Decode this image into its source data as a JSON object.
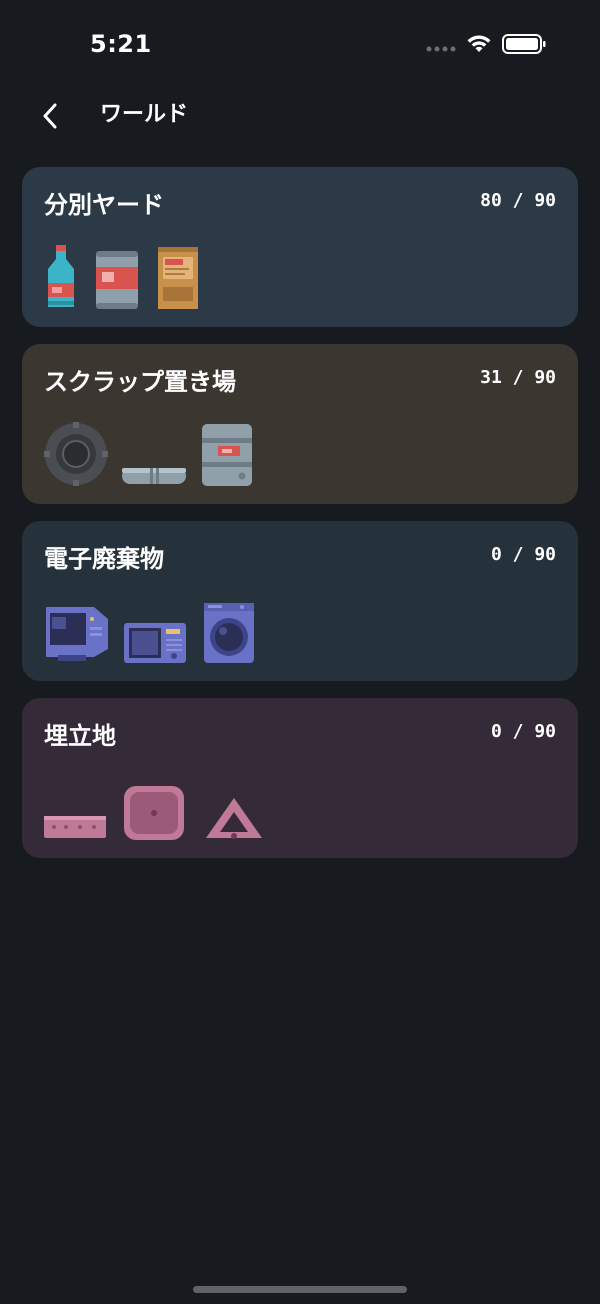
{
  "status_bar": {
    "time": "5:21"
  },
  "header": {
    "title": "ワールド",
    "back_icon": "chevron-left-icon"
  },
  "worlds": [
    {
      "name": "分別ヤード",
      "count": "80 / 90",
      "background": "#2b3a46",
      "items": [
        "bottle-icon",
        "can-icon",
        "cardboard-box-icon"
      ]
    },
    {
      "name": "スクラップ置き場",
      "count": "31 / 90",
      "background": "#3c3631",
      "items": [
        "tire-icon",
        "metal-pipe-icon",
        "oil-drum-icon"
      ]
    },
    {
      "name": "電子廃棄物",
      "count": "0 / 90",
      "background": "#26323b",
      "items": [
        "crt-monitor-icon",
        "microwave-icon",
        "washing-machine-icon"
      ]
    },
    {
      "name": "埋立地",
      "count": "0 / 90",
      "background": "#352b38",
      "items": [
        "plank-icon",
        "plastic-tray-icon",
        "warning-triangle-icon"
      ]
    }
  ]
}
